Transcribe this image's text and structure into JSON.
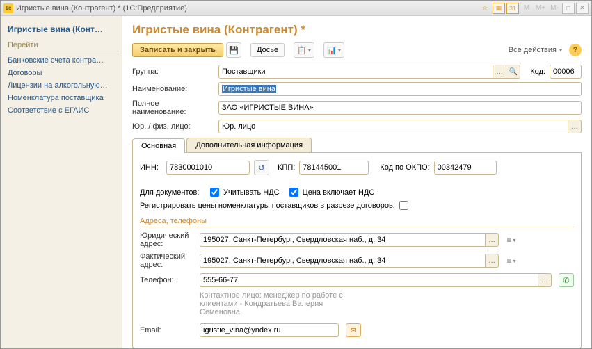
{
  "titlebar": {
    "text": "Игристые вина (Контрагент) * (1С:Предприятие)",
    "m_btns": [
      "M",
      "M+",
      "M-"
    ]
  },
  "sidebar": {
    "title": "Игристые вина (Конт…",
    "heading": "Перейти",
    "links": [
      "Банковские счета контра…",
      "Договоры",
      "Лицензии на алкогольную…",
      "Номенклатура поставщика",
      "Соответствие с ЕГАИС"
    ]
  },
  "page": {
    "title": "Игристые вина (Контрагент) *"
  },
  "toolbar": {
    "save_close": "Записать и закрыть",
    "dossier": "Досье",
    "all_actions": "Все действия"
  },
  "fields": {
    "group_label": "Группа:",
    "group_value": "Поставщики",
    "code_label": "Код:",
    "code_value": "00006",
    "name_label": "Наименование:",
    "name_value": "Игристые вина",
    "fullname_label": "Полное наименование:",
    "fullname_value": "ЗАО «ИГРИСТЫЕ ВИНА»",
    "type_label": "Юр. / физ. лицо:",
    "type_value": "Юр. лицо"
  },
  "tabs": {
    "main": "Основная",
    "extra": "Дополнительная информация"
  },
  "main_tab": {
    "inn_label": "ИНН:",
    "inn_value": "7830001010",
    "kpp_label": "КПП:",
    "kpp_value": "781445001",
    "okpo_label": "Код по ОКПО:",
    "okpo_value": "00342479",
    "docs_label": "Для документов:",
    "nds1": "Учитывать НДС",
    "nds2": "Цена включает НДС",
    "reg_prices": "Регистрировать цены номенклатуры поставщиков в разрезе договоров:",
    "section_addr": "Адреса, телефоны",
    "legal_addr_label": "Юридический адрес:",
    "legal_addr_value": "195027, Санкт-Петербург, Свердловская наб., д. 34",
    "fact_addr_label": "Фактический адрес:",
    "fact_addr_value": "195027, Санкт-Петербург, Свердловская наб., д. 34",
    "phone_label": "Телефон:",
    "phone_value": "555-66-77",
    "contact_hint": "Контактное лицо: менеджер по работе с клиентами - Кондратьева Валерия Семеновна",
    "email_label": "Email:",
    "email_value": "igristie_vina@yndex.ru"
  }
}
